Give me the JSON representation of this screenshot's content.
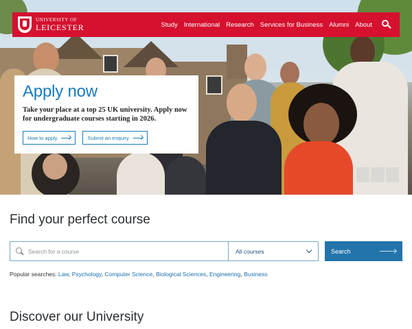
{
  "brand": {
    "line1": "UNIVERSITY OF",
    "line2": "LEICESTER",
    "color": "#d5112f"
  },
  "nav": {
    "items": [
      "Study",
      "International",
      "Research",
      "Services for Business",
      "Alumni",
      "About"
    ],
    "search_icon": "search-icon"
  },
  "hero": {
    "title": "Apply now",
    "text": "Take your place at a top 25 UK university. Apply now for undergraduate courses starting in 2026.",
    "buttons": [
      "How to apply",
      "Submit an enquiry"
    ],
    "media_controls": [
      "previous-icon",
      "pause-icon",
      "next-icon"
    ]
  },
  "course_search": {
    "heading": "Find your perfect course",
    "placeholder": "Search for a course",
    "filter_value": "All courses",
    "button_label": "Search",
    "popular_label": "Popular searches:",
    "popular_links": [
      "Law",
      "Psychology",
      "Computer Science",
      "Biological Sciences",
      "Engineering",
      "Business"
    ]
  },
  "discover": {
    "heading": "Discover our University"
  },
  "colors": {
    "accent_blue": "#1a7bbd",
    "button_blue": "#2374ab",
    "nav_red": "#d5112f"
  }
}
